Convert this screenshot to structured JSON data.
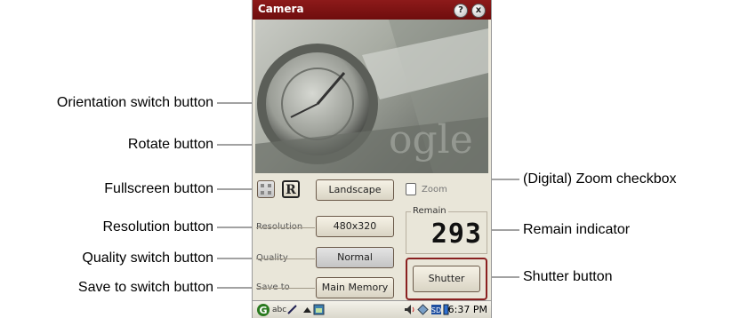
{
  "callouts": {
    "orientation": "Orientation switch button",
    "rotate": "Rotate button",
    "fullscreen": "Fullscreen button",
    "resolution": "Resolution button",
    "quality": "Quality switch button",
    "saveto": "Save to switch button",
    "zoom": "(Digital) Zoom checkbox",
    "remain": "Remain indicator",
    "shutter": "Shutter button"
  },
  "app": {
    "title": "Camera",
    "help_icon": "?",
    "close_icon": "x"
  },
  "controls": {
    "rotate_label": "R",
    "orientation_label": "Landscape",
    "zoom_label": "Zoom",
    "zoom_checked": false,
    "resolution_label": "Resolution",
    "resolution_value": "480x320",
    "quality_label": "Quality",
    "quality_value": "Normal",
    "saveto_label": "Save to",
    "saveto_value": "Main Memory",
    "remain_label": "Remain",
    "remain_value": "293",
    "shutter_label": "Shutter"
  },
  "taskbar": {
    "input_mode": "abc",
    "time": "6:37 PM",
    "icons": [
      "start-icon",
      "pen-icon",
      "up-arrow-icon",
      "app-icon",
      "speaker-icon",
      "sync-icon",
      "card-icon",
      "battery-icon"
    ]
  },
  "colors": {
    "titlebar": "#7a1212",
    "panel": "#e9e6d9",
    "shutter_border": "#8a2020"
  }
}
